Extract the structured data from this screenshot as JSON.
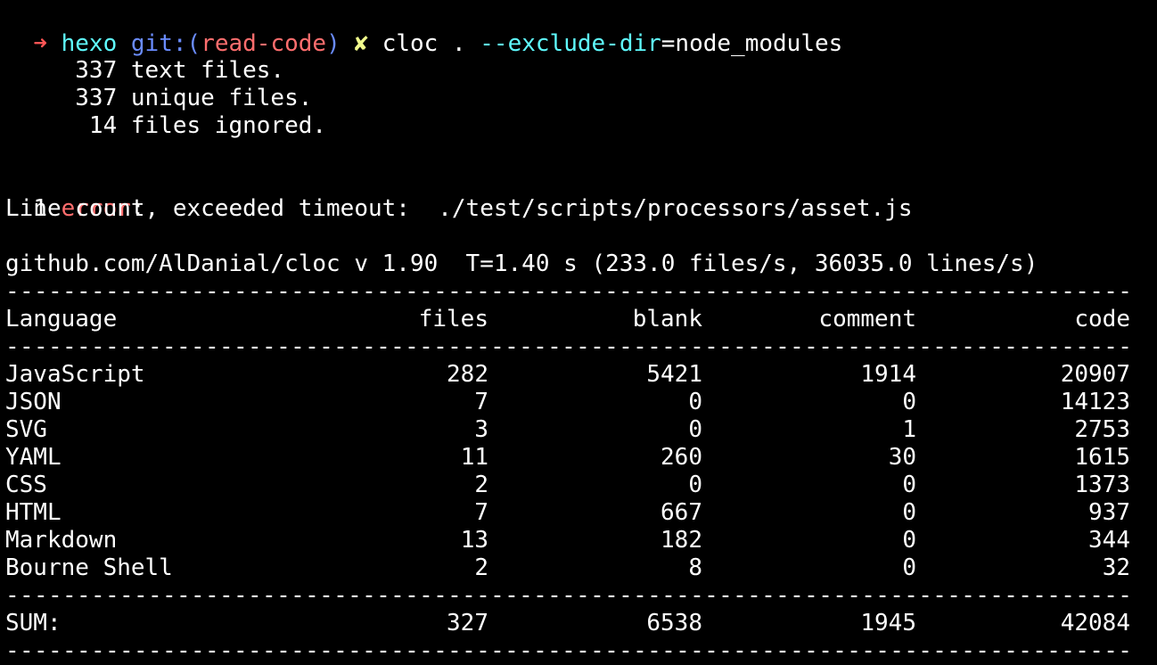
{
  "colors": {
    "background": "#000000",
    "foreground": "#ffffff",
    "arrow": "#ff5555",
    "dir": "#5ffbff",
    "git": "#6a8cff",
    "branch": "#ff6e6e",
    "dirty": "#f1fa8c",
    "flag": "#5ffbff",
    "error": "#ff6e6e"
  },
  "prompt": {
    "arrow": "➜",
    "dir": "hexo",
    "git_prefix": "git:(",
    "branch": "read-code",
    "git_suffix": ")",
    "dirty_mark": "✘",
    "command": "cloc .",
    "flag": "--exclude-dir",
    "flag_value": "=node_modules"
  },
  "summary": {
    "text_files": "     337 text files.",
    "unique_files": "     337 unique files.",
    "ignored": "      14 files ignored."
  },
  "error": {
    "count": "1",
    "label": "error",
    "colon": ":",
    "message": "Line count, exceeded timeout:  ./test/scripts/processors/asset.js"
  },
  "banner": "github.com/AlDanial/cloc v 1.90  T=1.40 s (233.0 files/s, 36035.0 lines/s)",
  "divider": "-----------------------------------------------------------------------------------",
  "table": {
    "headers": [
      "Language",
      "files",
      "blank",
      "comment",
      "code"
    ],
    "rows": [
      [
        "JavaScript",
        "282",
        "5421",
        "1914",
        "20907"
      ],
      [
        "JSON",
        "7",
        "0",
        "0",
        "14123"
      ],
      [
        "SVG",
        "3",
        "0",
        "1",
        "2753"
      ],
      [
        "YAML",
        "11",
        "260",
        "30",
        "1615"
      ],
      [
        "CSS",
        "2",
        "0",
        "0",
        "1373"
      ],
      [
        "HTML",
        "7",
        "667",
        "0",
        "937"
      ],
      [
        "Markdown",
        "13",
        "182",
        "0",
        "344"
      ],
      [
        "Bourne Shell",
        "2",
        "8",
        "0",
        "32"
      ]
    ],
    "sum": [
      "SUM:",
      "327",
      "6538",
      "1945",
      "42084"
    ]
  }
}
